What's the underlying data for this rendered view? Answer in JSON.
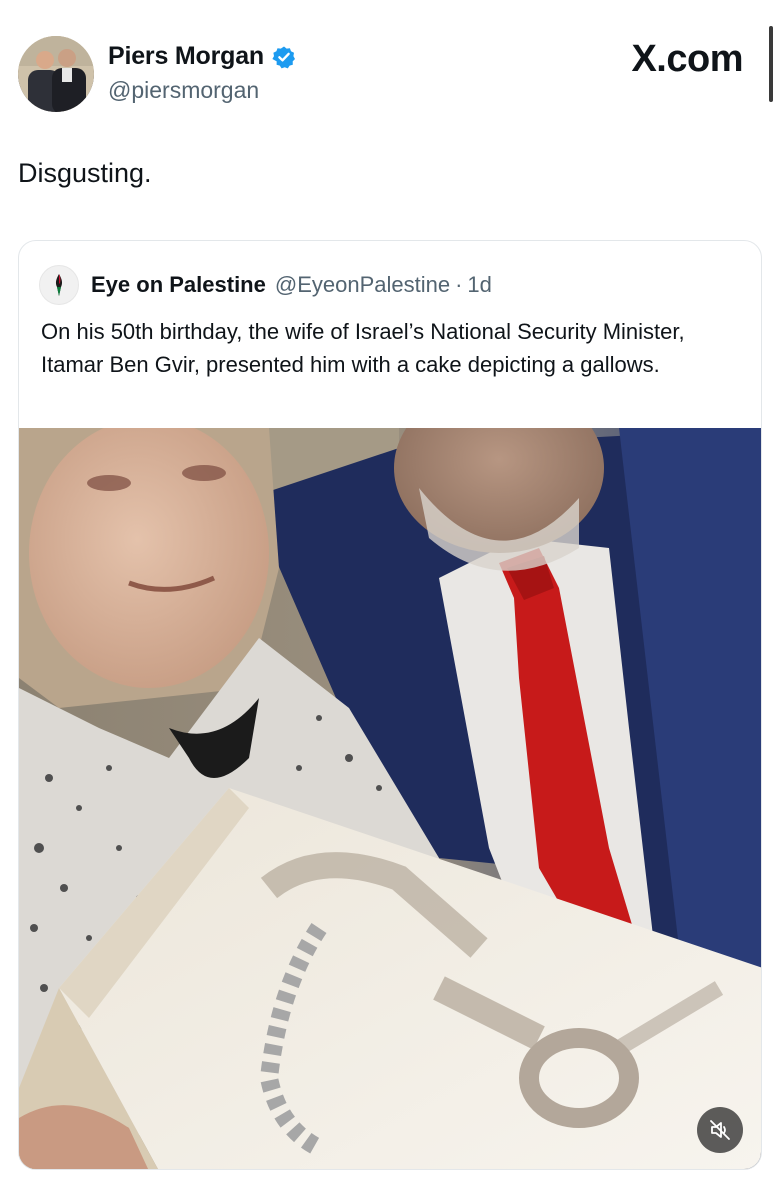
{
  "post": {
    "author": {
      "name": "Piers Morgan",
      "handle": "@piersmorgan",
      "verified": true,
      "avatar_icon": "profile-photo-two-men"
    },
    "text": "Disgusting."
  },
  "header": {
    "site_logo": "X.com"
  },
  "quoted_post": {
    "author": {
      "name": "Eye on Palestine",
      "handle": "@EyeonPalestine",
      "avatar_icon": "eye-on-palestine-logo"
    },
    "separator": "·",
    "time": "1d",
    "text": "On his 50th birthday, the wife of Israel’s National Security Minister, Itamar Ben Gvir, presented him with a cake depicting a gallows.",
    "media": {
      "type": "video",
      "description_icon": "video-frame",
      "muted": true,
      "mute_icon": "speaker-muted-icon"
    }
  },
  "colors": {
    "text_primary": "#0f1419",
    "text_secondary": "#536471",
    "verified_blue": "#1d9bf0",
    "card_border": "#e3e7ea"
  }
}
